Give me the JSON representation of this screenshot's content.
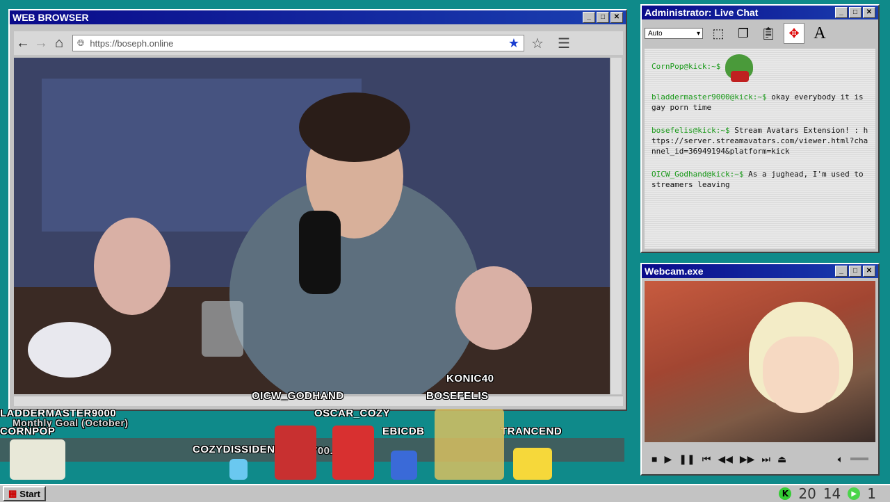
{
  "browser": {
    "title": "WEB BROWSER",
    "url": "https://boseph.online",
    "buttons": {
      "min": "_",
      "max": "□",
      "close": "✕"
    }
  },
  "chat": {
    "title": "Administrator: Live Chat",
    "select_value": "Auto",
    "messages": [
      {
        "user": "CornPop@kick:~$",
        "text": ""
      },
      {
        "user": "bladdermaster9000@kick:~$",
        "text": "okay everybody it is gay porn time"
      },
      {
        "user": "bosefelis@kick:~$",
        "text": "Stream Avatars Extension! : https://server.streamavatars.com/viewer.html?channel_id=36949194&platform=kick"
      },
      {
        "user": "OICW_Godhand@kick:~$",
        "text": "As a jughead, I'm used to streamers leaving"
      }
    ]
  },
  "webcam": {
    "title": "Webcam.exe"
  },
  "overlay": {
    "names": {
      "konic": "KONIC40",
      "godhand": "OICW_GODHAND",
      "bosefelis": "BOSEFELIS",
      "bladder": "LADDERMASTER9000",
      "oscar": "OSCAR_COZY",
      "cornpop": "CORNPOP",
      "ebicdb": "EBICDB",
      "trancend": "TRANCEND",
      "cozydissident": "COZYDISSIDENT"
    },
    "goal_label": "Monthly Goal (October)",
    "goal_value": "700.0",
    "goal_value_suffix": "%)"
  },
  "taskbar": {
    "start": "Start",
    "counter1": "20",
    "counter2": "14",
    "counter3": "1"
  },
  "colors": {
    "desktop": "#0f8a8a",
    "titlebar": "#0a0a8a",
    "chat_user": "#1a9a1a"
  }
}
